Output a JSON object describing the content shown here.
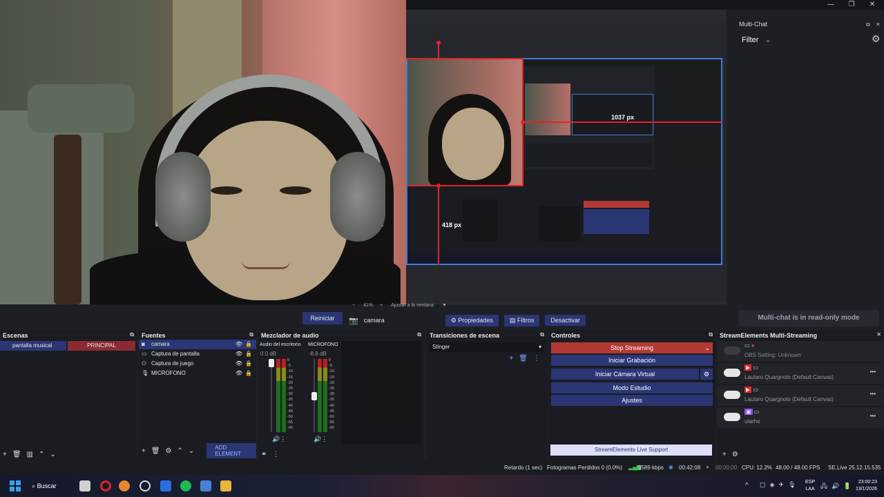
{
  "window": {
    "minimize": "—",
    "maximize": "❐",
    "close": "✕"
  },
  "preview": {
    "measure_h": "1037 px",
    "measure_v": "418 px",
    "zoom": "41%",
    "zoom_minus": "−",
    "zoom_plus": "+",
    "fit_label": "Ajustar a la ventana",
    "fit_arrow": "▼"
  },
  "multichat": {
    "title": "Multi-Chat",
    "filter": "Filter",
    "readonly": "Multi-chat is in read-only mode"
  },
  "source_toolbar": {
    "restart": "Reiniciar",
    "source_name": "camara",
    "properties": "Propiedades",
    "filters": "Filtros",
    "deactivate": "Desactivar"
  },
  "scenes": {
    "title": "Escenas",
    "items": [
      "pantalla musical",
      "PRINCIPAL"
    ]
  },
  "sources": {
    "title": "Fuentes",
    "items": [
      "camara",
      "Captura de pantalla",
      "Captura de juego",
      "MICROFONO"
    ],
    "add_element": "ADD ELEMENT"
  },
  "mixer": {
    "title": "Mezclador de audio",
    "channels": [
      {
        "name": "Audio del escritorio",
        "db": "0.0 dB"
      },
      {
        "name": "MICROFONO",
        "db": "-8.8 dB"
      }
    ],
    "scale": [
      "0",
      "-5",
      "-10",
      "-15",
      "-20",
      "-25",
      "-30",
      "-35",
      "-40",
      "-45",
      "-50",
      "-55",
      "-60"
    ]
  },
  "transitions": {
    "title": "Transiciones de escena",
    "selected": "Stinger"
  },
  "controls": {
    "title": "Controles",
    "stop_streaming": "Stop Streaming",
    "start_recording": "Iniciar Grabación",
    "virtual_cam": "Iniciar Cámara Virtual",
    "studio_mode": "Modo Estudio",
    "settings": "Ajustes",
    "support": "StreamElements Live Support"
  },
  "multistream": {
    "title": "StreamElements Multi-Streaming",
    "items": [
      {
        "label": "OBS Setting: Unknown",
        "platform": "none",
        "enabled": false
      },
      {
        "label": "Lautaro Quargnolo (Default Canvas)",
        "platform": "youtube",
        "enabled": false
      },
      {
        "label": "Lautaro Quargnolo (Default Canvas)",
        "platform": "youtube",
        "enabled": false
      },
      {
        "label": "utarho",
        "platform": "twitch",
        "enabled": false
      }
    ],
    "more": "•••"
  },
  "status": {
    "delay": "Retardo (1 sec)",
    "dropped": "Fotogramas Perdidos 0 (0.0%)",
    "bitrate": "3589 kbps",
    "stream_time": "00:42:08",
    "rec_time": "00:00:00",
    "cpu": "CPU: 12.2%",
    "fps": "48.00 / 48.00 FPS",
    "version": "SE.Live 25.12.15.535"
  },
  "taskbar": {
    "search": "Buscar",
    "lang1": "ESP",
    "lang2": "LAA",
    "time": "23:00:23",
    "date": "13/1/2026",
    "tray_arrow": "^"
  },
  "colors": {
    "accent_blue": "#2b3675",
    "stop_red": "#b33935",
    "preview_border": "#3d7ed8",
    "measure_red": "#e0232b"
  }
}
